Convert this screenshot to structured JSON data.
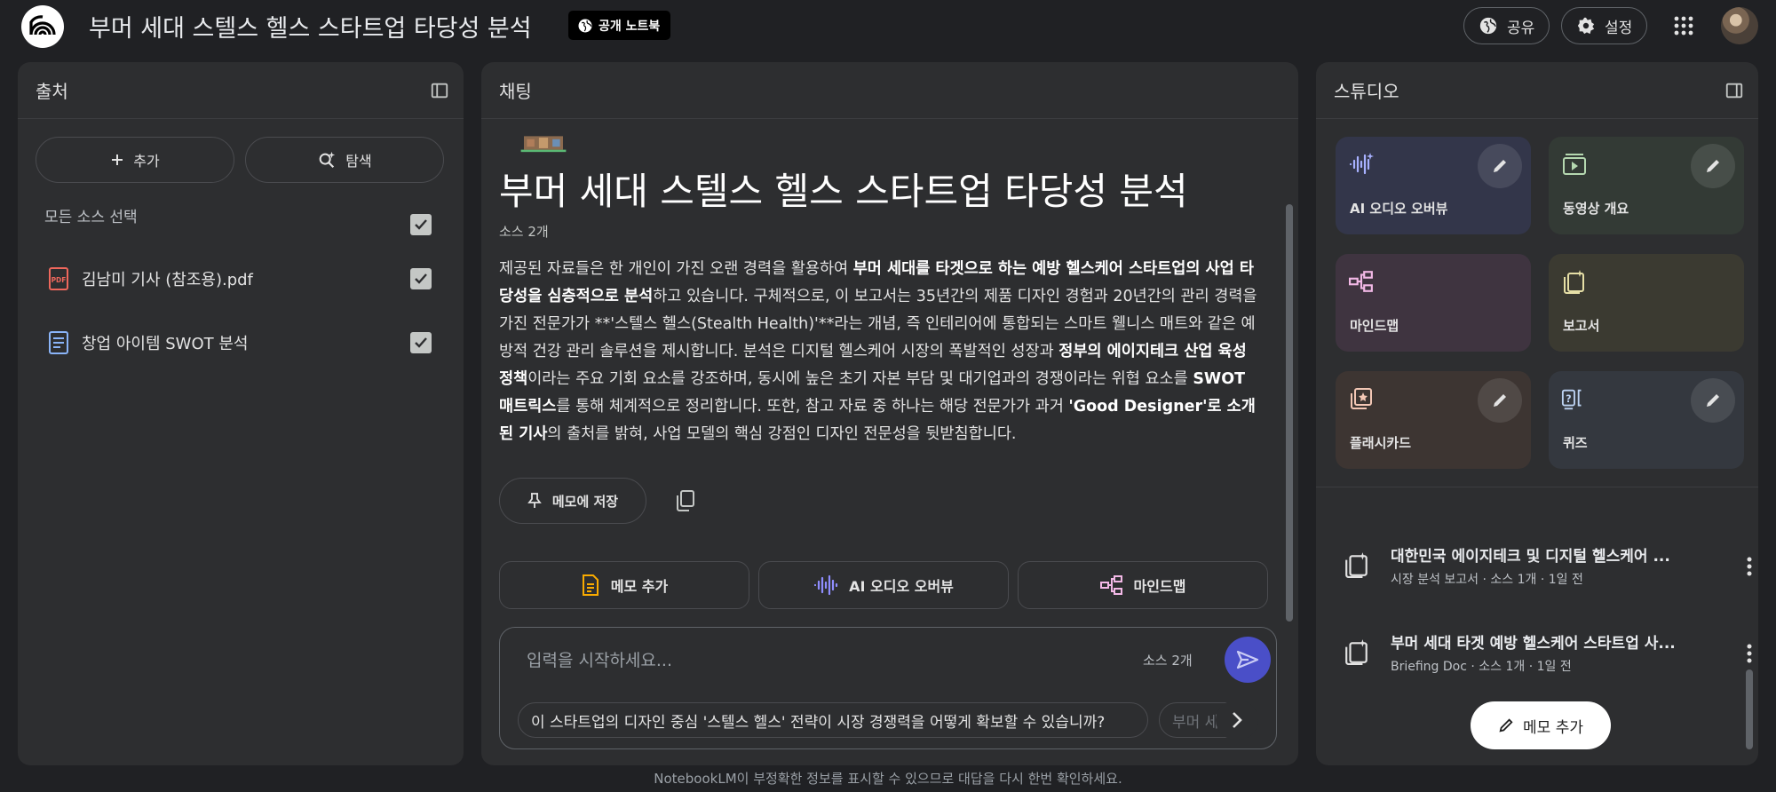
{
  "header": {
    "title": "부머 세대 스텔스 헬스 스타트업 타당성 분석",
    "public_badge": "공개 노트북",
    "share_label": "공유",
    "settings_label": "설정"
  },
  "sources": {
    "title": "출처",
    "add_label": "추가",
    "explore_label": "탐색",
    "select_all_label": "모든 소스 선택",
    "items": [
      {
        "name": "김남미 기사 (참조용).pdf",
        "type": "pdf",
        "checked": true
      },
      {
        "name": "창업 아이템 SWOT 분석",
        "type": "doc",
        "checked": true
      }
    ]
  },
  "chat": {
    "title": "채팅",
    "notebook_title": "부머 세대 스텔스 헬스 스타트업 타당성 분석",
    "source_count": "소스 2개",
    "summary": [
      {
        "t": "제공된 자료들은 한 개인이 가진 오랜 경력을 활용하여 ",
        "b": false
      },
      {
        "t": "부머 세대를 타겟으로 하는 예방 헬스케어 스타트업의 사업 타당성을 심층적으로 분석",
        "b": true
      },
      {
        "t": "하고 있습니다. 구체적으로, 이 보고서는 35년간의 제품 디자인 경험과 20년간의 관리 경력을 가진 전문가가 **'스텔스 헬스(Stealth Health)'**라는 개념, 즉 인테리어에 통합되는 스마트 웰니스 매트와 같은 예방적 건강 관리 솔루션을 제시합니다. 분석은 디지털 헬스케어 시장의 폭발적인 성장과 ",
        "b": false
      },
      {
        "t": "정부의 에이지테크 산업 육성 정책",
        "b": true
      },
      {
        "t": "이라는 주요 기회 요소를 강조하며, 동시에 높은 초기 자본 부담 및 대기업과의 경쟁이라는 위협 요소를 ",
        "b": false
      },
      {
        "t": "SWOT 매트릭스",
        "b": true
      },
      {
        "t": "를 통해 체계적으로 정리합니다. 또한, 참고 자료 중 하나는 해당 전문가가 과거 ",
        "b": false
      },
      {
        "t": "'Good Designer'로 소개된 기사",
        "b": true
      },
      {
        "t": "의 출처를 밝혀, 사업 모델의 핵심 강점인 디자인 전문성을 뒷받침합니다.",
        "b": false
      }
    ],
    "save_memo_label": "메모에 저장",
    "quick_actions": [
      {
        "label": "메모 추가",
        "icon": "note-icon"
      },
      {
        "label": "AI 오디오 오버뷰",
        "icon": "audio-wave-icon"
      },
      {
        "label": "마인드맵",
        "icon": "mindmap-icon"
      }
    ],
    "input_placeholder": "입력을 시작하세요...",
    "input_source_count": "소스 2개",
    "suggestions": [
      "이 스타트업의 디자인 중심 '스텔스 헬스' 전략이 시장 경쟁력을 어떻게 확보할 수 있습니까?",
      "부머 세대"
    ]
  },
  "studio": {
    "title": "스튜디오",
    "tiles": [
      {
        "label": "AI 오디오 오버뷰",
        "color": "#33364a",
        "icon_color": "#a8b1ff",
        "editable": true
      },
      {
        "label": "동영상 개요",
        "color": "#333a35",
        "icon_color": "#b5d8b0",
        "editable": true
      },
      {
        "label": "마인드맵",
        "color": "#3f3440",
        "icon_color": "#f2b8e6",
        "editable": false
      },
      {
        "label": "보고서",
        "color": "#3b3a31",
        "icon_color": "#e6dfa6",
        "editable": false
      },
      {
        "label": "플래시카드",
        "color": "#3d3532",
        "icon_color": "#f3c7b5",
        "editable": true
      },
      {
        "label": "퀴즈",
        "color": "#34383f",
        "icon_color": "#bcd2f2",
        "editable": true
      }
    ],
    "notes": [
      {
        "title": "대한민국 에이지테크 및 디지털 헬스케어 ...",
        "subtitle": "시장 분석 보고서 · 소스 1개 · 1일 전"
      },
      {
        "title": "부머 세대 타겟 예방 헬스케어 스타트업 사...",
        "subtitle": "Briefing Doc · 소스 1개 · 1일 전"
      }
    ],
    "add_note_label": "메모 추가"
  },
  "footer": {
    "disclaimer": "NotebookLM이 부정확한 정보를 표시할 수 있으므로 대답을 다시 한번 확인하세요."
  }
}
